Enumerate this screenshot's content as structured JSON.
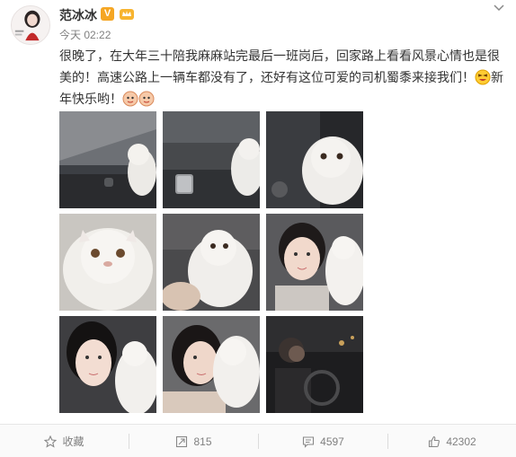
{
  "user": {
    "name": "范冰冰",
    "verified_label": "V"
  },
  "post": {
    "time": "今天 02:22",
    "text": "很晚了，在大年三十陪我麻麻站完最后一班岗后，回家路上看看风景心情也是很美的！高速公路上一辆车都没有了，还好有这位可爱的司机蜀黍来接我们！",
    "text_tail": "新年快乐哟！"
  },
  "photos": [
    {
      "subject": "cat-in-car-window"
    },
    {
      "subject": "cat-car-mirror"
    },
    {
      "subject": "cat-closeup-car"
    },
    {
      "subject": "cat-face-closeup"
    },
    {
      "subject": "cat-held-night"
    },
    {
      "subject": "woman-with-cat"
    },
    {
      "subject": "woman-selfie-cat"
    },
    {
      "subject": "woman-kissing-cat"
    },
    {
      "subject": "driver-in-car"
    }
  ],
  "actions": {
    "favorite_label": "收藏",
    "repost_count": "815",
    "comment_count": "4597",
    "like_count": "42302"
  },
  "colors": {
    "accent": "#f5a623",
    "muted": "#808080",
    "text": "#333333"
  }
}
